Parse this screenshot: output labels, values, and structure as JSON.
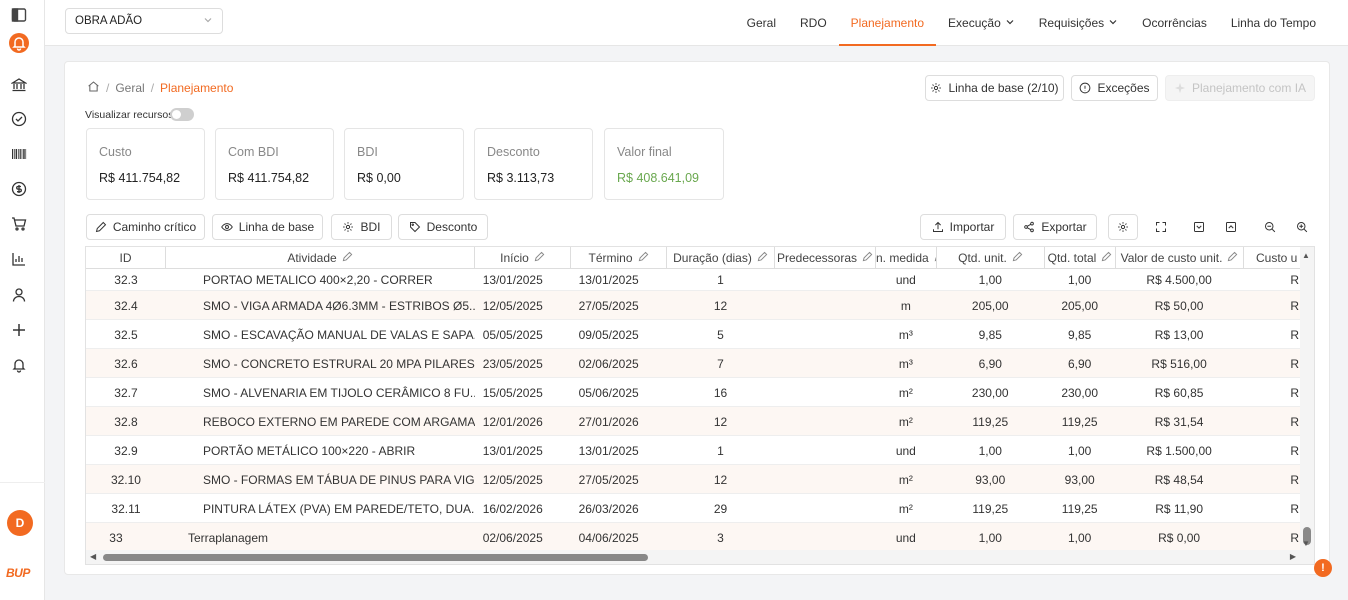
{
  "project": {
    "name": "OBRA ADÃO"
  },
  "nav": [
    {
      "label": "Geral",
      "dropdown": false,
      "active": false
    },
    {
      "label": "RDO",
      "dropdown": false,
      "active": false
    },
    {
      "label": "Planejamento",
      "dropdown": false,
      "active": true
    },
    {
      "label": "Execução",
      "dropdown": true,
      "active": false
    },
    {
      "label": "Requisições",
      "dropdown": true,
      "active": false
    },
    {
      "label": "Ocorrências",
      "dropdown": false,
      "active": false
    },
    {
      "label": "Linha do Tempo",
      "dropdown": false,
      "active": false
    }
  ],
  "breadcrumb": {
    "geral": "Geral",
    "current": "Planejamento"
  },
  "header_buttons": {
    "baseline": "Linha de base (2/10)",
    "exceptions": "Exceções",
    "ai_planning": "Planejamento com IA"
  },
  "toggle": {
    "label": "Visualizar recursos"
  },
  "kpis": [
    {
      "label": "Custo",
      "value": "R$ 411.754,82"
    },
    {
      "label": "Com BDI",
      "value": "R$ 411.754,82"
    },
    {
      "label": "BDI",
      "value": "R$ 0,00"
    },
    {
      "label": "Desconto",
      "value": "R$ 3.113,73"
    },
    {
      "label": "Valor final",
      "value": "R$ 408.641,09"
    }
  ],
  "toolbar": {
    "critical_path": "Caminho crítico",
    "baseline": "Linha de base",
    "bdi": "BDI",
    "discount": "Desconto",
    "import": "Importar",
    "export": "Exportar"
  },
  "columns": [
    "ID",
    "Atividade",
    "Início",
    "Término",
    "Duração (dias)",
    "Predecessoras",
    "Un. medida",
    "Qtd. unit.",
    "Qtd. total",
    "Valor de custo unit.",
    "Custo u"
  ],
  "rows": [
    [
      "32.3",
      "PORTAO METALICO 400×2,20 - CORRER",
      "13/01/2025",
      "13/01/2025",
      "1",
      "",
      "und",
      "1,00",
      "1,00",
      "R$ 4.500,00",
      "R"
    ],
    [
      "32.4",
      "SMO - VIGA ARMADA 4Ø6.3MM - ESTRIBOS Ø5...",
      "12/05/2025",
      "27/05/2025",
      "12",
      "",
      "m",
      "205,00",
      "205,00",
      "R$ 50,00",
      "R"
    ],
    [
      "32.5",
      "SMO - ESCAVAÇÃO MANUAL DE VALAS E SAPA...",
      "05/05/2025",
      "09/05/2025",
      "5",
      "",
      "m³",
      "9,85",
      "9,85",
      "R$ 13,00",
      "R"
    ],
    [
      "32.6",
      "SMO - CONCRETO ESTRURAL 20 MPA PILARES...",
      "23/05/2025",
      "02/06/2025",
      "7",
      "",
      "m³",
      "6,90",
      "6,90",
      "R$ 516,00",
      "R"
    ],
    [
      "32.7",
      "SMO - ALVENARIA EM TIJOLO CERÂMICO 8 FU...",
      "15/05/2025",
      "05/06/2025",
      "16",
      "",
      "m²",
      "230,00",
      "230,00",
      "R$ 60,85",
      "R"
    ],
    [
      "32.8",
      "REBOCO EXTERNO EM PAREDE COM ARGAMA...",
      "12/01/2026",
      "27/01/2026",
      "12",
      "",
      "m²",
      "119,25",
      "119,25",
      "R$ 31,54",
      "R"
    ],
    [
      "32.9",
      "PORTÃO METÁLICO 100×220 - ABRIR",
      "13/01/2025",
      "13/01/2025",
      "1",
      "",
      "und",
      "1,00",
      "1,00",
      "R$ 1.500,00",
      "R"
    ],
    [
      "32.10",
      "SMO - FORMAS EM TÁBUA DE PINUS PARA VIG...",
      "12/05/2025",
      "27/05/2025",
      "12",
      "",
      "m²",
      "93,00",
      "93,00",
      "R$ 48,54",
      "R"
    ],
    [
      "32.11",
      "PINTURA LÁTEX (PVA) EM PAREDE/TETO, DUA...",
      "16/02/2026",
      "26/03/2026",
      "29",
      "",
      "m²",
      "119,25",
      "119,25",
      "R$ 11,90",
      "R"
    ],
    [
      "33",
      "Terraplanagem",
      "02/06/2025",
      "04/06/2025",
      "3",
      "",
      "und",
      "1,00",
      "1,00",
      "R$ 0,00",
      "R"
    ]
  ],
  "user": {
    "initial": "D"
  },
  "brand": {
    "logo_text": "BUP",
    "accent": "#f26a21",
    "value_green": "#6aa84f"
  }
}
